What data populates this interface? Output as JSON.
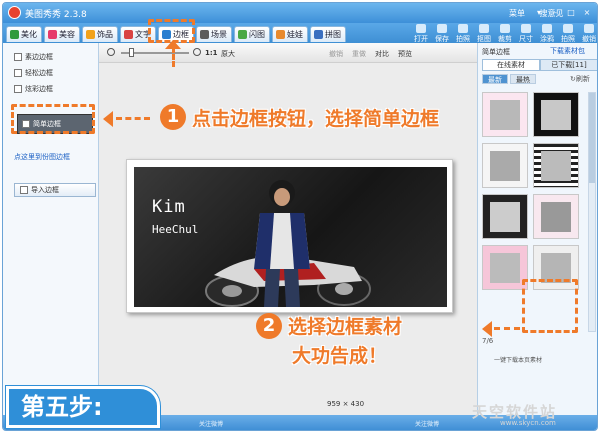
{
  "app": {
    "title": "美图秀秀 2.3.8",
    "links": [
      "菜单",
      "搜意见"
    ]
  },
  "tabs": [
    {
      "label": "美化",
      "color": "#2f9a3d"
    },
    {
      "label": "美容",
      "color": "#e63a6b"
    },
    {
      "label": "饰品",
      "color": "#f2a21a"
    },
    {
      "label": "文字",
      "color": "#d94343"
    },
    {
      "label": "边框",
      "color": "#2a7fd0"
    },
    {
      "label": "场景",
      "color": "#5c5c5c"
    },
    {
      "label": "闪图",
      "color": "#4aa845"
    },
    {
      "label": "娃娃",
      "color": "#e88a2e"
    },
    {
      "label": "拼图",
      "color": "#3a6fc0"
    }
  ],
  "top_icons": [
    "打开",
    "保存",
    "拍照",
    "抠图",
    "裁剪",
    "尺寸",
    "涂鸦",
    "拍照",
    "撤销"
  ],
  "left_panel": {
    "items": [
      "素边边框",
      "轻松边框",
      "炫彩边框",
      "",
      "简单边框"
    ],
    "link": "点这里到份图边框",
    "import": "导入边框"
  },
  "canvas": {
    "zoom": "1:1",
    "orig": "原大",
    "actions": [
      "撤销",
      "重做",
      "",
      "对比",
      "预览"
    ],
    "photo_text1": "Kim",
    "photo_text2": "HeeChul",
    "dims": "959 × 430"
  },
  "right_panel": {
    "title": "简单边框",
    "link": "下载素材包",
    "tabs": [
      "在线素材",
      "已下载[11]"
    ],
    "subtabs": [
      "最新",
      "最热"
    ],
    "refresh": "刷新",
    "pager": "7/6",
    "download": "一键下载本页素材"
  },
  "statusbar": {
    "left": "关注微博",
    "right": "关注微博"
  },
  "callouts": {
    "step1_num": "1",
    "step1": "点击边框按钮，选择简单边框",
    "step2_num": "2",
    "step2_line1": "选择边框素材",
    "step2_line2": "大功告成！"
  },
  "step_badge": "第五步:",
  "watermark": {
    "text": "天空软件站",
    "url": "www.skycn.com"
  },
  "colors": {
    "accent": "#ef7a2a",
    "brand": "#3d8fd8"
  }
}
